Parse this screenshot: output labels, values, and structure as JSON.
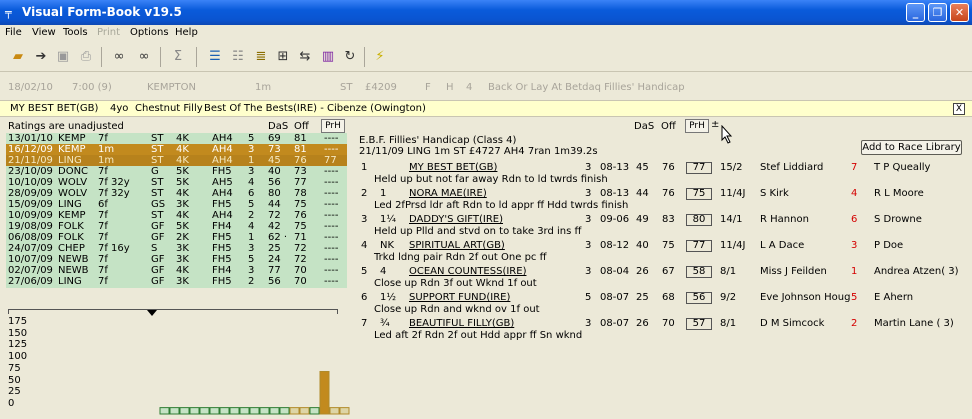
{
  "window": {
    "title": "Visual Form-Book v19.5",
    "app_icon": "╤",
    "minimize_glyph": "_",
    "maximize_glyph": "❐",
    "close_glyph": "✕"
  },
  "menu": [
    "File",
    "View",
    "Tools",
    "Print",
    "Options",
    "Help"
  ],
  "toolbar_icons": [
    "open-folder-icon",
    "arrow-right-icon",
    "save-icon",
    "print-icon",
    "binoculars-icon",
    "binoculars-next-icon",
    "sigma-icon",
    "list-view-icon",
    "grid-view-icon",
    "notes-icon",
    "ruler-icon",
    "transfer-icon",
    "bar-chart-icon",
    "refresh-icon",
    "lightning-icon"
  ],
  "race_line": {
    "date": "18/02/10",
    "time": "7:00 (9)",
    "course": "KEMPTON",
    "distance": "1m",
    "going": "ST",
    "prize": "£4209",
    "sex": "F",
    "h": "H",
    "runners": "4",
    "name": "Back Or Lay At Betdaq Fillies' Handicap"
  },
  "bet_bar": {
    "horse": "MY BEST BET(GB)",
    "age": "4yo",
    "desc": "Chestnut Filly",
    "breeding": "Best Of The Bests(IRE) - Cibenze (Owington)",
    "close": "X"
  },
  "left_panel": {
    "note": "Ratings are unadjusted",
    "headers": {
      "das": "DaS",
      "off": "Off",
      "prh": "PrH"
    },
    "rows": [
      {
        "date": "13/01/10",
        "course": "KEMP",
        "dist": "7f",
        "going": "ST",
        "cls": "4K",
        "race": "AH4",
        "pos": "5",
        "das": "69",
        "off": "81",
        "prh": "----",
        "style": "green"
      },
      {
        "date": "16/12/09",
        "course": "KEMP",
        "dist": "1m",
        "going": "ST",
        "cls": "4K",
        "race": "AH4",
        "pos": "3",
        "das": "73",
        "off": "81",
        "prh": "----",
        "style": "gold"
      },
      {
        "date": "21/11/09",
        "course": "LING",
        "dist": "1m",
        "going": "ST",
        "cls": "4K",
        "race": "AH4",
        "pos": "1",
        "das": "45",
        "off": "76",
        "prh": "77",
        "style": "gold2"
      },
      {
        "date": "23/10/09",
        "course": "DONC",
        "dist": "7f",
        "going": "G",
        "cls": "5K",
        "race": "FH5",
        "pos": "3",
        "das": "40",
        "off": "73",
        "prh": "----",
        "style": "green"
      },
      {
        "date": "10/10/09",
        "course": "WOLV",
        "dist": "7f 32y",
        "going": "ST",
        "cls": "5K",
        "race": "AH5",
        "pos": "4",
        "das": "56",
        "off": "77",
        "prh": "----",
        "style": "green"
      },
      {
        "date": "28/09/09",
        "course": "WOLV",
        "dist": "7f 32y",
        "going": "ST",
        "cls": "4K",
        "race": "AH4",
        "pos": "6",
        "das": "80",
        "off": "78",
        "prh": "----",
        "style": "green"
      },
      {
        "date": "15/09/09",
        "course": "LING",
        "dist": "6f",
        "going": "GS",
        "cls": "3K",
        "race": "FH5",
        "pos": "5",
        "das": "44",
        "off": "75",
        "prh": "----",
        "style": "green"
      },
      {
        "date": "10/09/09",
        "course": "KEMP",
        "dist": "7f",
        "going": "ST",
        "cls": "4K",
        "race": "AH4",
        "pos": "2",
        "das": "72",
        "off": "76",
        "prh": "----",
        "style": "green"
      },
      {
        "date": "19/08/09",
        "course": "FOLK",
        "dist": "7f",
        "going": "GF",
        "cls": "5K",
        "race": "FH4",
        "pos": "4",
        "das": "42",
        "off": "75",
        "prh": "----",
        "style": "green"
      },
      {
        "date": "06/08/09",
        "course": "FOLK",
        "dist": "7f",
        "going": "GF",
        "cls": "2K",
        "race": "FH5",
        "pos": "1",
        "das": "62 ·",
        "off": "71",
        "prh": "----",
        "style": "green"
      },
      {
        "date": "24/07/09",
        "course": "CHEP",
        "dist": "7f 16y",
        "going": "S",
        "cls": "3K",
        "race": "FH5",
        "pos": "3",
        "das": "25",
        "off": "72",
        "prh": "----",
        "style": "green"
      },
      {
        "date": "10/07/09",
        "course": "NEWB",
        "dist": "7f",
        "going": "GF",
        "cls": "3K",
        "race": "FH5",
        "pos": "5",
        "das": "24",
        "off": "72",
        "prh": "----",
        "style": "green"
      },
      {
        "date": "02/07/09",
        "course": "NEWB",
        "dist": "7f",
        "going": "GF",
        "cls": "4K",
        "race": "FH4",
        "pos": "3",
        "das": "77",
        "off": "70",
        "prh": "----",
        "style": "green"
      },
      {
        "date": "27/06/09",
        "course": "LING",
        "dist": "7f",
        "going": "GF",
        "cls": "3K",
        "race": "FH5",
        "pos": "2",
        "das": "56",
        "off": "70",
        "prh": "----",
        "style": "green"
      }
    ],
    "yaxis_labels": [
      "175",
      "150",
      "125",
      "100",
      "75",
      "50",
      "25",
      "0"
    ]
  },
  "chart_data": {
    "type": "bar",
    "ylim": [
      0,
      175
    ],
    "yticks": [
      175,
      150,
      125,
      100,
      75,
      50,
      25,
      0
    ],
    "values": [
      12,
      12,
      12,
      12,
      12,
      12,
      12,
      12,
      12,
      12,
      12,
      12,
      12,
      12,
      12,
      12,
      80,
      12,
      12
    ],
    "colors": [
      "#c5e3c5",
      "#c5e3c5",
      "#c5e3c5",
      "#c5e3c5",
      "#c5e3c5",
      "#c5e3c5",
      "#c5e3c5",
      "#c5e3c5",
      "#c5e3c5",
      "#c5e3c5",
      "#c5e3c5",
      "#c5e3c5",
      "#c5e3c5",
      "#ded5a6",
      "#ded5a6",
      "#c5e3c5",
      "#c28a1e",
      "#ded5a6",
      "#ded5a6"
    ]
  },
  "right_panel": {
    "headers": {
      "das": "DaS",
      "off": "Off",
      "prh": "PrH"
    },
    "sort_icon": "±",
    "race_title": "E.B.F. Fillies' Handicap (Class 4)",
    "race_sub": "21/11/09 LING 1m     ST £4727   AH4  7ran 1m39.2s",
    "add_button": "Add to Race Library",
    "runners": [
      {
        "pos": "1",
        "dist": "",
        "horse": "MY BEST BET(GB)",
        "age": "3",
        "wt": "08-13",
        "das": "45",
        "off": "76",
        "prh": "77",
        "sp": "15/2",
        "trainer": "Stef Liddiard",
        "draw": "7",
        "jockey": "T P Queally",
        "comment": "Held up but not far away Rdn to ld twrds finish"
      },
      {
        "pos": "2",
        "dist": "1",
        "horse": "NORA MAE(IRE)",
        "age": "3",
        "wt": "08-13",
        "das": "44",
        "off": "76",
        "prh": "75",
        "sp": "11/4J",
        "trainer": "S Kirk",
        "draw": "4",
        "jockey": "R L Moore",
        "comment": "Led 2fPrsd ldr aft Rdn to ld appr ff Hdd twrds finish"
      },
      {
        "pos": "3",
        "dist": "1¼",
        "horse": "DADDY'S GIFT(IRE)",
        "age": "3",
        "wt": "09-06",
        "das": "49",
        "off": "83",
        "prh": "80",
        "sp": "14/1",
        "trainer": "R Hannon",
        "draw": "6",
        "jockey": "S Drowne",
        "comment": "Held up Plld and stvd on to take 3rd ins ff"
      },
      {
        "pos": "4",
        "dist": "NK",
        "horse": "SPIRITUAL ART(GB)",
        "age": "3",
        "wt": "08-12",
        "das": "40",
        "off": "75",
        "prh": "77",
        "sp": "11/4J",
        "trainer": "L A Dace",
        "draw": "3",
        "jockey": "P Doe",
        "comment": "Trkd ldng pair Rdn 2f out One pc ff"
      },
      {
        "pos": "5",
        "dist": "4",
        "horse": "OCEAN COUNTESS(IRE)",
        "age": "3",
        "wt": "08-04",
        "das": "26",
        "off": "67",
        "prh": "58",
        "sp": "8/1",
        "trainer": "Miss J Feilden",
        "draw": "1",
        "jockey": "Andrea Atzen( 3)",
        "comment": "Close up Rdn 3f out Wknd 1f out"
      },
      {
        "pos": "6",
        "dist": "1½",
        "horse": "SUPPORT FUND(IRE)",
        "age": "5",
        "wt": "08-07",
        "das": "25",
        "off": "68",
        "prh": "56",
        "sp": "9/2",
        "trainer": "Eve Johnson Houg",
        "draw": "5",
        "jockey": "E Ahern",
        "comment": "Close up Rdn and wknd ov 1f out"
      },
      {
        "pos": "7",
        "dist": "¾",
        "horse": "BEAUTIFUL FILLY(GB)",
        "age": "3",
        "wt": "08-07",
        "das": "26",
        "off": "70",
        "prh": "57",
        "sp": "8/1",
        "trainer": "D M Simcock",
        "draw": "2",
        "jockey": "Martin Lane ( 3)",
        "comment": "Led aft 2f Rdn 2f out Hdd appr ff Sn wknd"
      }
    ]
  }
}
